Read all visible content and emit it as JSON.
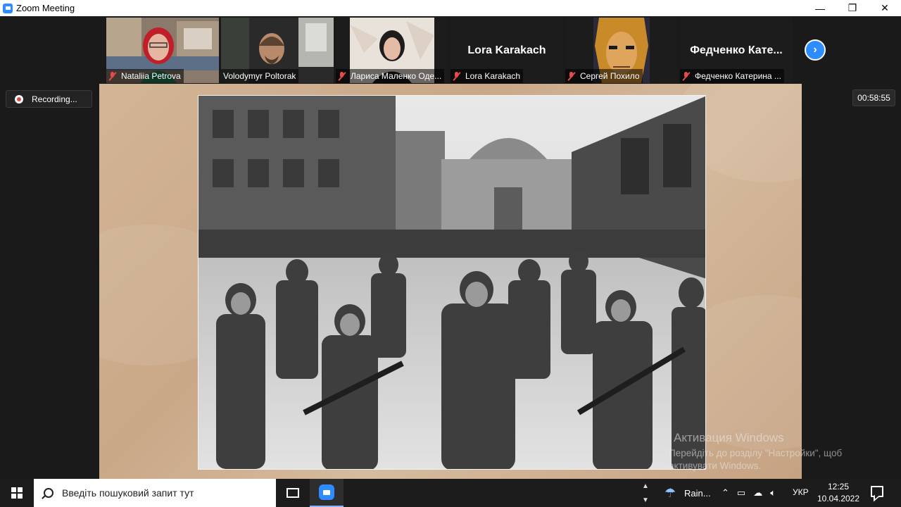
{
  "window": {
    "title": "Zoom Meeting",
    "controls": {
      "minimize": "—",
      "maximize": "❐",
      "close": "✕"
    }
  },
  "participants": [
    {
      "name": "Nataliia Petrova",
      "muted": true,
      "video": true,
      "active": false
    },
    {
      "name": "Volodymyr Poltorak",
      "muted": false,
      "video": true,
      "active": true
    },
    {
      "name": "Лариса Маленко Оде...",
      "muted": true,
      "video": true,
      "active": false
    },
    {
      "name": "Lora Karakach",
      "display_name": "Lora Karakach",
      "muted": true,
      "video": false,
      "active": false
    },
    {
      "name": "Сергей Похило",
      "muted": true,
      "video": true,
      "active": false
    },
    {
      "name": "Федченко Катерина ...",
      "display_name": "Федченко  Кате...",
      "muted": true,
      "video": false,
      "active": false
    }
  ],
  "controls": {
    "next_icon": "chevron-right-icon",
    "recording_label": "Recording...",
    "timer": "00:58:55"
  },
  "activation": {
    "title": "Активация Windows",
    "text": "Перейдіть до розділу \"Настройки\", щоб активувати Windows."
  },
  "taskbar": {
    "search_placeholder": "Введіть пошуковий запит тут",
    "weather": "Rain...",
    "language": "УКР",
    "time": "12:25",
    "date": "10.04.2022"
  },
  "colors": {
    "zoom_blue": "#2d8cff",
    "active_speaker": "#c4d82e",
    "muted_red": "#e54b4b"
  }
}
